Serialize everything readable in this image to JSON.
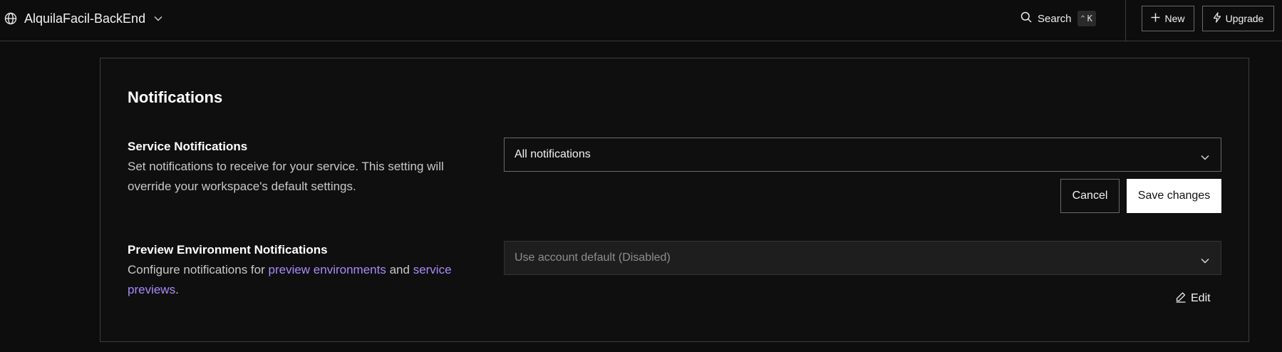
{
  "header": {
    "project_name": "AlquilaFacil-BackEnd",
    "search_label": "Search",
    "search_shortcut": "K",
    "new_button": "New",
    "upgrade_button": "Upgrade"
  },
  "notifications": {
    "title": "Notifications",
    "service": {
      "title": "Service Notifications",
      "description": "Set notifications to receive for your service. This setting will override your workspace's default settings.",
      "selected_option": "All notifications",
      "cancel_label": "Cancel",
      "save_label": "Save changes"
    },
    "preview": {
      "title": "Preview Environment Notifications",
      "description_prefix": "Configure notifications for ",
      "link_preview_environments": "preview environments",
      "description_and": " and",
      "link_service_previews": "service previews",
      "description_suffix": ".",
      "selected_option": "Use account default (Disabled)",
      "edit_label": "Edit"
    }
  },
  "colors": {
    "background": "#0d0d0d",
    "panel_border": "#3d3d3d",
    "link": "#a78bfa",
    "save_button_bg": "#ffffff"
  },
  "icons": {
    "project": "globe-icon",
    "search": "search-icon",
    "new": "plus-icon",
    "upgrade": "bolt-icon",
    "dropdown": "chevron-down-icon",
    "edit": "pencil-icon"
  }
}
